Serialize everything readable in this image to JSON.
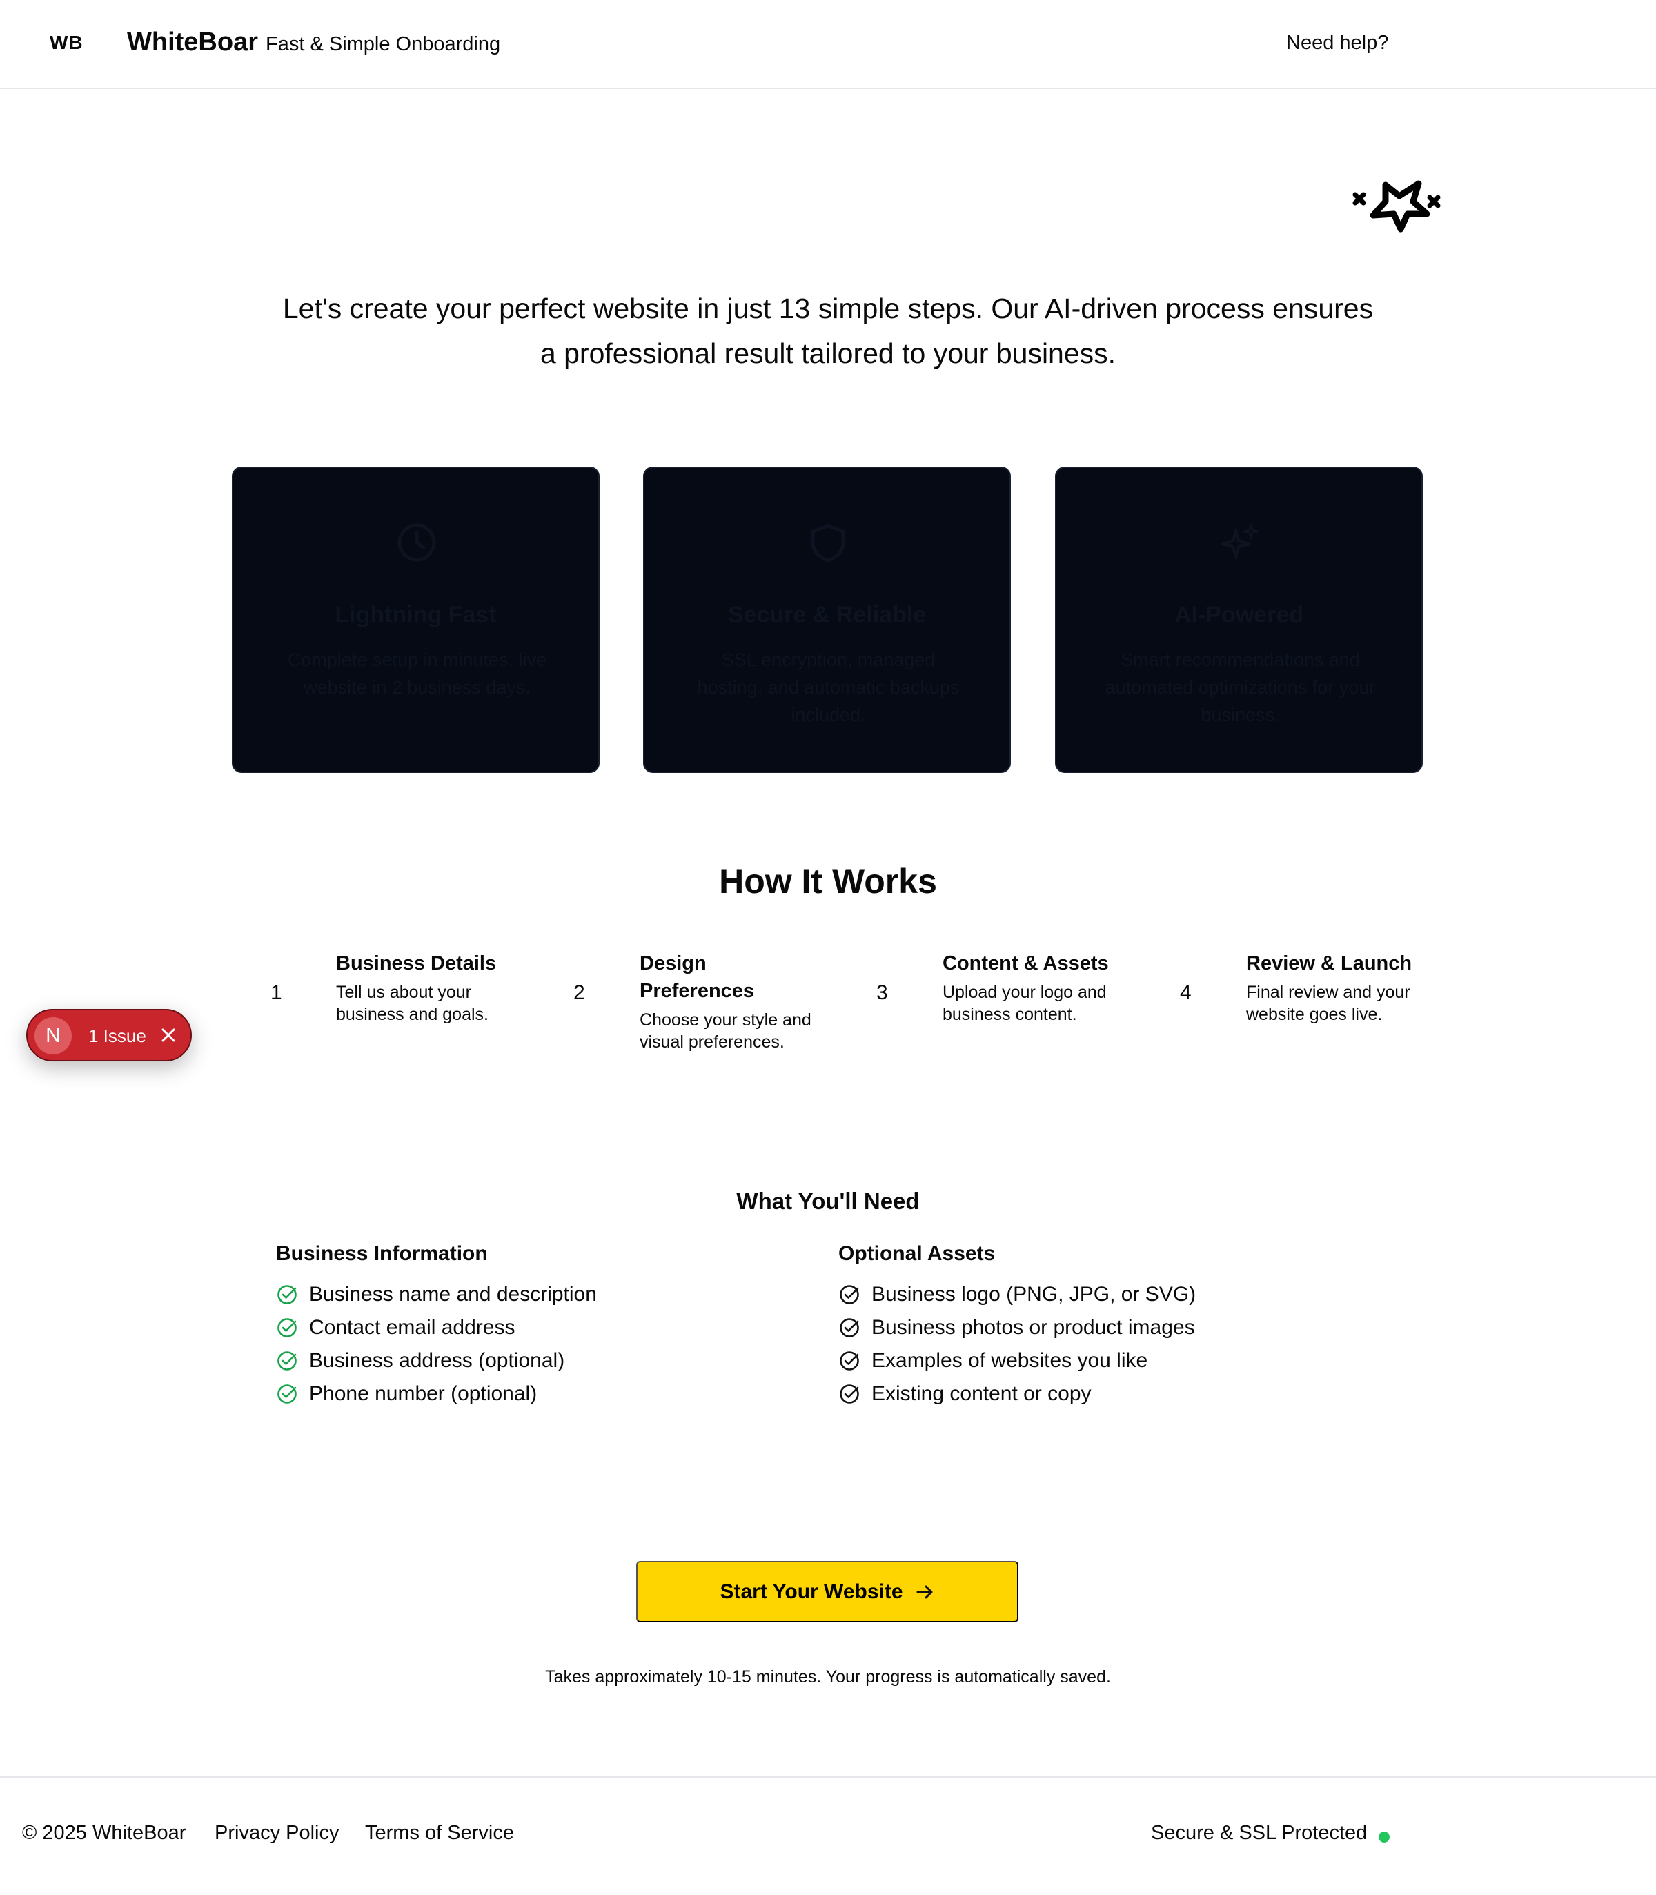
{
  "header": {
    "logo_mark": "WB",
    "brand_name": "WhiteBoar",
    "tagline": "Fast & Simple Onboarding",
    "help_link": "Need help?"
  },
  "hero": {
    "icon": "sparkle-star-icon",
    "intro": "Let's create your perfect website in just 13 simple steps. Our AI-driven process ensures a professional result tailored to your business."
  },
  "features": [
    {
      "icon": "clock-icon",
      "title": "Lightning Fast",
      "description": "Complete setup in minutes, live website in 2 business days."
    },
    {
      "icon": "shield-icon",
      "title": "Secure & Reliable",
      "description": "SSL encryption, managed hosting, and automatic backups included."
    },
    {
      "icon": "sparkles-icon",
      "title": "AI-Powered",
      "description": "Smart recommendations and automated optimizations for your business."
    }
  ],
  "how_it_works": {
    "title": "How It Works",
    "steps": [
      {
        "number": "1",
        "title": "Business Details",
        "description": "Tell us about your business and goals."
      },
      {
        "number": "2",
        "title": "Design Preferences",
        "description": "Choose your style and visual preferences."
      },
      {
        "number": "3",
        "title": "Content & Assets",
        "description": "Upload your logo and business content."
      },
      {
        "number": "4",
        "title": "Review & Launch",
        "description": "Final review and your website goes live."
      }
    ]
  },
  "issue_badge": {
    "letter": "N",
    "label": "1 Issue"
  },
  "requirements": {
    "title": "What You'll Need",
    "business_info": {
      "heading": "Business Information",
      "items": [
        "Business name and description",
        "Contact email address",
        "Business address (optional)",
        "Phone number (optional)"
      ],
      "check_color": "#16a34a"
    },
    "optional_assets": {
      "heading": "Optional Assets",
      "items": [
        "Business logo (PNG, JPG, or SVG)",
        "Business photos or product images",
        "Examples of websites you like",
        "Existing content or copy"
      ],
      "check_color": "#111111"
    }
  },
  "cta": {
    "label": "Start Your Website",
    "note": "Takes approximately 10-15 minutes. Your progress is automatically saved.",
    "color": "#ffd500"
  },
  "footer": {
    "copyright": "© 2025 WhiteBoar",
    "privacy": "Privacy Policy",
    "terms": "Terms of Service",
    "secure": "Secure & SSL Protected",
    "status_color": "#22c55e"
  }
}
